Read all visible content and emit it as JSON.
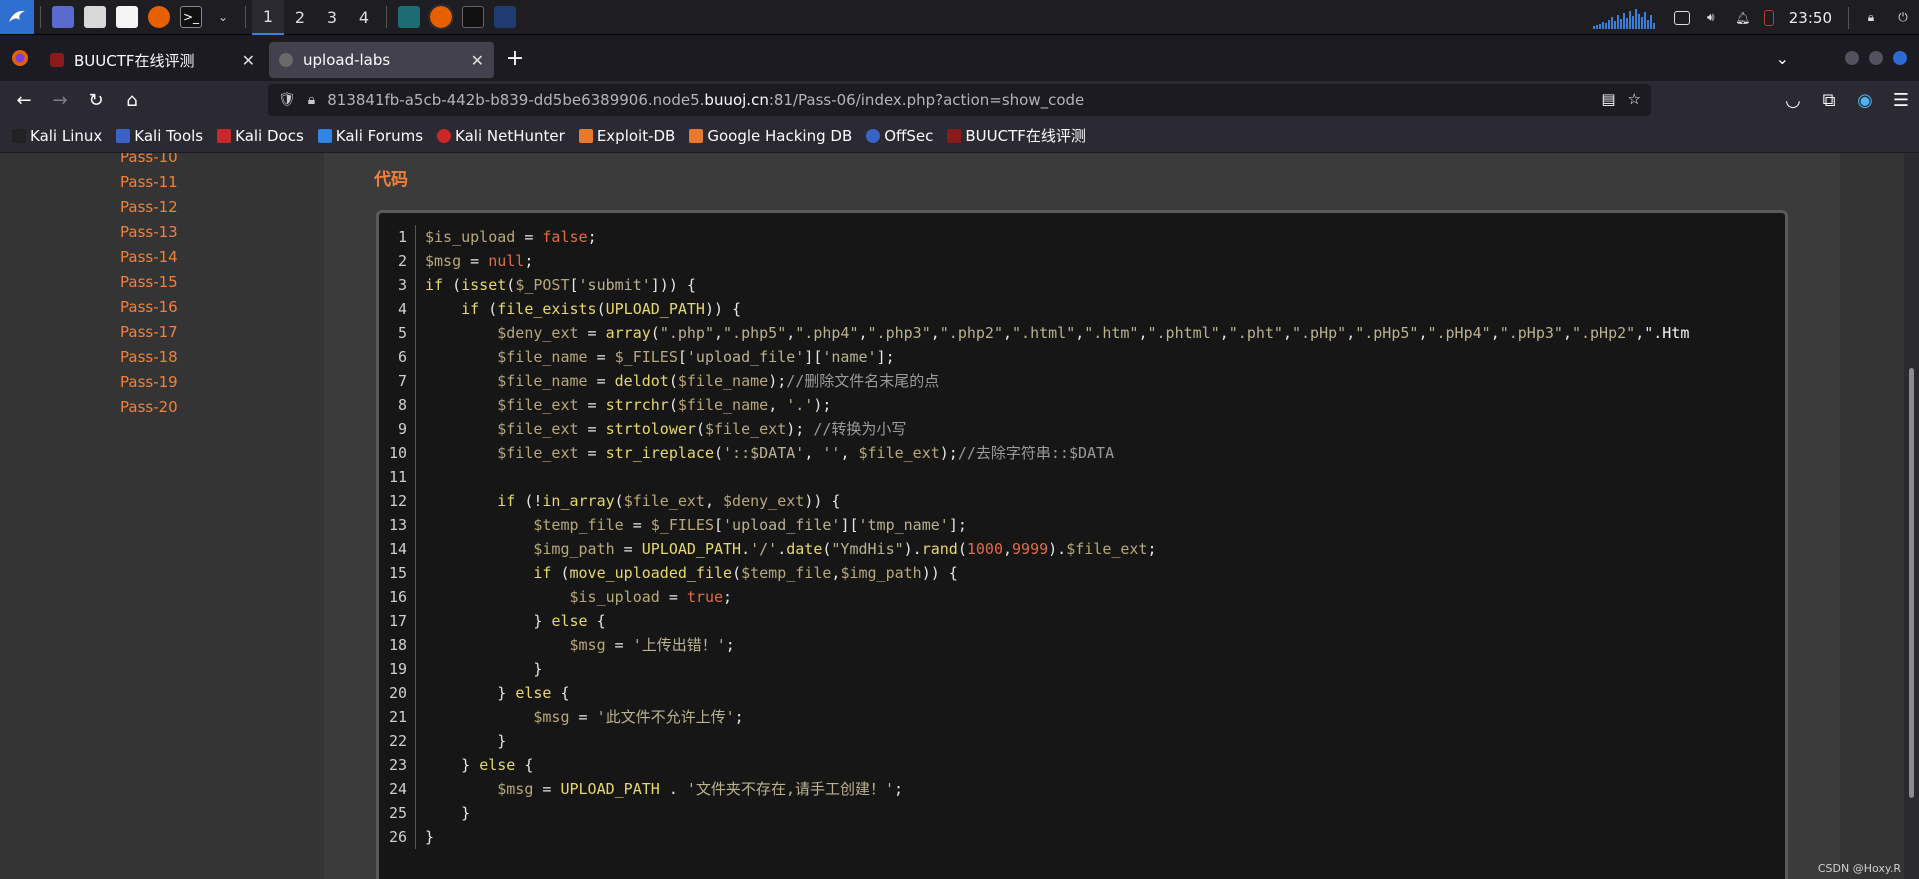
{
  "system_bar": {
    "workspaces": [
      "1",
      "2",
      "3",
      "4"
    ],
    "active_workspace": "1",
    "clock": "23:50"
  },
  "browser": {
    "tabs": [
      {
        "title": "BUUCTF在线评测",
        "active": false
      },
      {
        "title": "upload-labs",
        "active": true
      }
    ],
    "url_prefix": "813841fb-a5cb-442b-b839-dd5be6389906.node5.",
    "url_host": "buuoj.cn",
    "url_suffix": ":81/Pass-06/index.php?action=show_code",
    "bookmarks": [
      "Kali Linux",
      "Kali Tools",
      "Kali Docs",
      "Kali Forums",
      "Kali NetHunter",
      "Exploit-DB",
      "Google Hacking DB",
      "OffSec",
      "BUUCTF在线评测"
    ]
  },
  "sidebar": {
    "pass_items": [
      "Pass-10",
      "Pass-11",
      "Pass-12",
      "Pass-13",
      "Pass-14",
      "Pass-15",
      "Pass-16",
      "Pass-17",
      "Pass-18",
      "Pass-19",
      "Pass-20"
    ]
  },
  "main": {
    "section_title": "代码",
    "code_lines": [
      "$is_upload = false;",
      "$msg = null;",
      "if (isset($_POST['submit'])) {",
      "    if (file_exists(UPLOAD_PATH)) {",
      "        $deny_ext = array(\".php\",\".php5\",\".php4\",\".php3\",\".php2\",\".html\",\".htm\",\".phtml\",\".pht\",\".pHp\",\".pHp5\",\".pHp4\",\".pHp3\",\".pHp2\",\".Htm",
      "        $file_name = $_FILES['upload_file']['name'];",
      "        $file_name = deldot($file_name);//删除文件名末尾的点",
      "        $file_ext = strrchr($file_name, '.');",
      "        $file_ext = strtolower($file_ext); //转换为小写",
      "        $file_ext = str_ireplace('::$DATA', '', $file_ext);//去除字符串::$DATA",
      "",
      "        if (!in_array($file_ext, $deny_ext)) {",
      "            $temp_file = $_FILES['upload_file']['tmp_name'];",
      "            $img_path = UPLOAD_PATH.'/'.date(\"YmdHis\").rand(1000,9999).$file_ext;",
      "            if (move_uploaded_file($temp_file,$img_path)) {",
      "                $is_upload = true;",
      "            } else {",
      "                $msg = '上传出错！';",
      "            }",
      "        } else {",
      "            $msg = '此文件不允许上传';",
      "        }",
      "    } else {",
      "        $msg = UPLOAD_PATH . '文件夹不存在,请手工创建！';",
      "    }",
      "}"
    ]
  },
  "watermark": "CSDN @Hoxy.R"
}
